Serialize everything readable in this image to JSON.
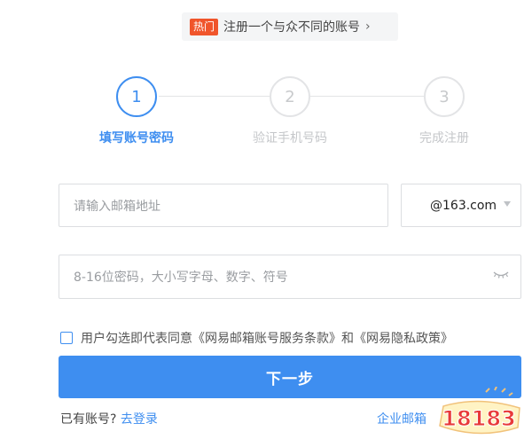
{
  "promo": {
    "badge": "热门",
    "text": "注册一个与众不同的账号",
    "arrow": "›"
  },
  "steps": [
    {
      "number": "1",
      "label": "填写账号密码",
      "active": true
    },
    {
      "number": "2",
      "label": "验证手机号码",
      "active": false
    },
    {
      "number": "3",
      "label": "完成注册",
      "active": false
    }
  ],
  "form": {
    "email_placeholder": "请输入邮箱地址",
    "domain_value": "@163.com",
    "password_placeholder": "8-16位密码，大小写字母、数字、符号"
  },
  "agreement": {
    "text": "用户勾选即代表同意《网易邮箱账号服务条款》和《网易隐私政策》"
  },
  "buttons": {
    "next": "下一步"
  },
  "footer": {
    "have_account": "已有账号?",
    "login_link": "去登录",
    "enterprise_link": "企业邮箱"
  },
  "watermark": {
    "text": "18183"
  },
  "colors": {
    "accent": "#3e8ef0",
    "badge": "#f0552b",
    "watermark": "#e83a3a"
  },
  "icons": {
    "dropdown": "caret-down-icon",
    "password_toggle": "eye-closed-icon",
    "promo_arrow": "chevron-right-icon"
  }
}
